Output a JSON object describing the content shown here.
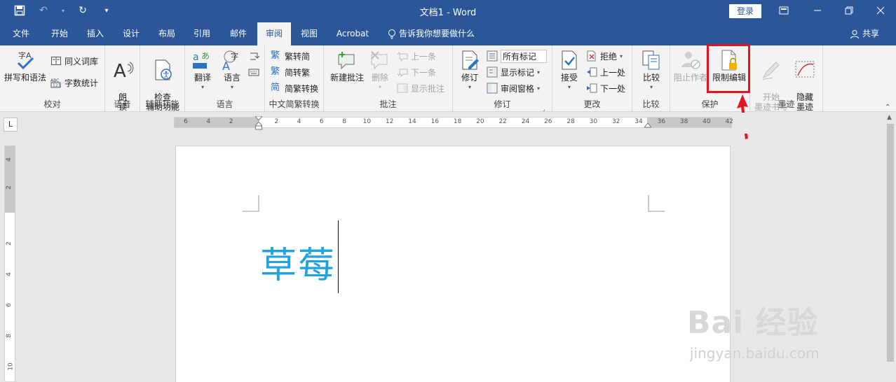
{
  "title_bar": {
    "doc_title": "文档1  -  Word",
    "login_label": "登录"
  },
  "tabs": [
    {
      "label": "文件"
    },
    {
      "label": "开始"
    },
    {
      "label": "插入"
    },
    {
      "label": "设计"
    },
    {
      "label": "布局"
    },
    {
      "label": "引用"
    },
    {
      "label": "邮件"
    },
    {
      "label": "审阅"
    },
    {
      "label": "视图"
    },
    {
      "label": "Acrobat"
    }
  ],
  "active_tab": "审阅",
  "tell_me": "告诉我你想要做什么",
  "share": "共享",
  "ribbon": {
    "proofing": {
      "label": "校对",
      "spelling": "拼写和语法",
      "thesaurus": "同义词库",
      "word_count": "字数统计"
    },
    "speech": {
      "label": "语音",
      "read_aloud": "朗\n读"
    },
    "accessibility": {
      "label": "辅助功能",
      "check": "检查\n辅助功能"
    },
    "language": {
      "label": "语言",
      "translate": "翻译",
      "language": "语言"
    },
    "chinese_conv": {
      "label": "中文简繁转换",
      "t2s": "繁转简",
      "s2t": "简转繁",
      "convert": "简繁转换"
    },
    "comments": {
      "label": "批注",
      "new_comment": "新建批注",
      "delete": "删除",
      "previous": "上一条",
      "next": "下一条",
      "show_comments": "显示批注"
    },
    "tracking": {
      "label": "修订",
      "track_changes": "修订",
      "markup_select": "所有标记",
      "show_markup": "显示标记",
      "review_pane": "审阅窗格"
    },
    "changes": {
      "label": "更改",
      "accept": "接受",
      "reject": "拒绝",
      "previous": "上一处",
      "next": "下一处"
    },
    "compare": {
      "label": "比较",
      "compare": "比较"
    },
    "protect": {
      "label": "保护",
      "block_authors": "阻止作者",
      "restrict_editing": "限制编辑"
    },
    "ink": {
      "label": "墨迹",
      "start_inking": "开始\n墨迹书写",
      "hide_ink": "隐藏\n墨迹"
    }
  },
  "ruler": {
    "h_numbers": [
      "6",
      "4",
      "2",
      "2",
      "4",
      "6",
      "8",
      "10",
      "12",
      "14",
      "16",
      "18",
      "20",
      "22",
      "24",
      "26",
      "28",
      "30",
      "32",
      "34",
      "36",
      "38",
      "40",
      "42"
    ],
    "v_numbers": [
      "4",
      "2",
      "2",
      "4",
      "6",
      "8",
      "10"
    ]
  },
  "document": {
    "text": "草莓"
  },
  "watermark": {
    "main": "Bai 经验",
    "sub": "jingyan.baidu.com"
  },
  "colors": {
    "title_blue": "#2b579a",
    "doc_text": "#1fa3e0",
    "highlight_red": "#e3141f"
  }
}
